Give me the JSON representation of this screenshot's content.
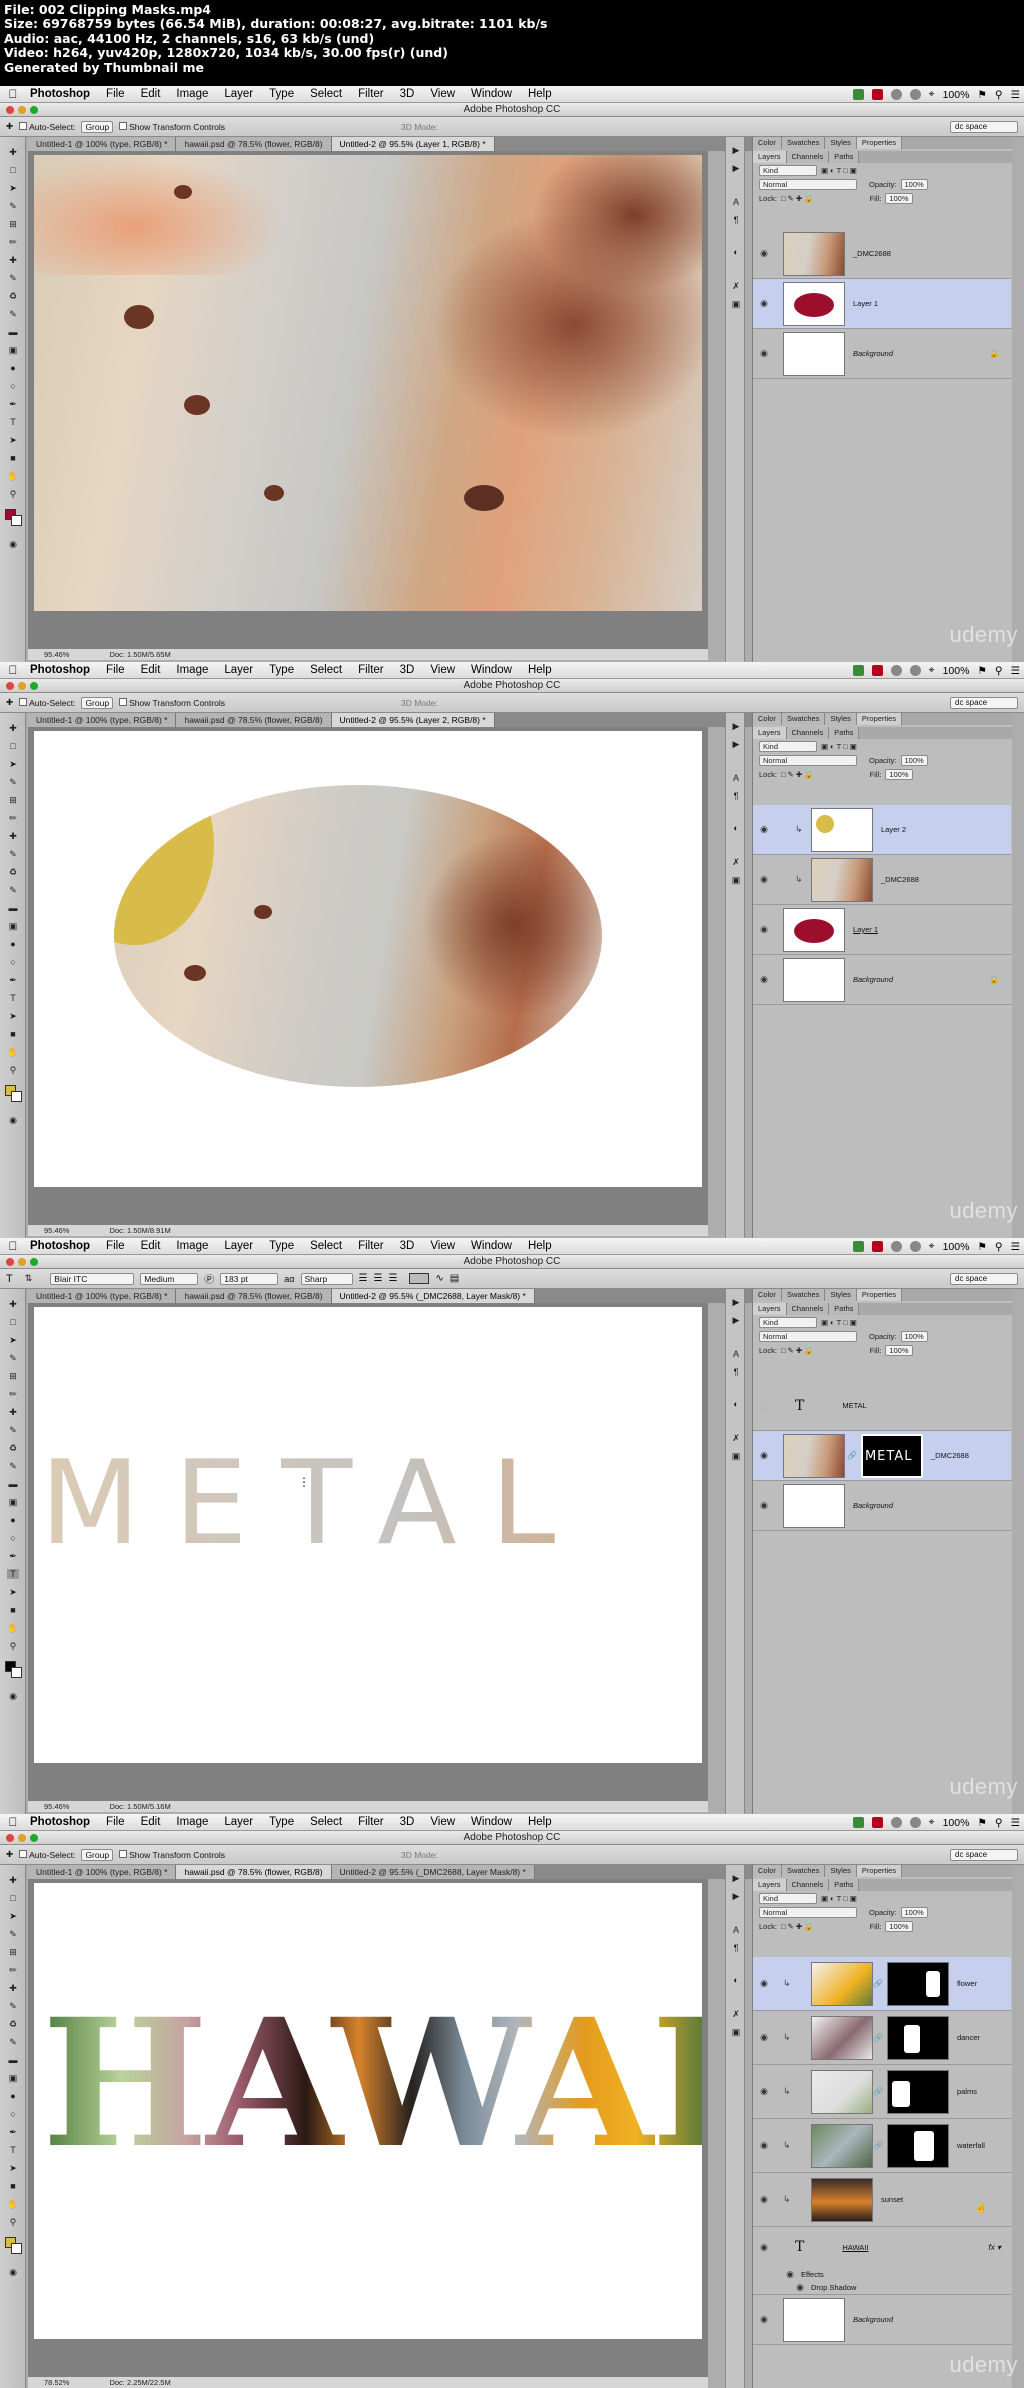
{
  "header": {
    "line1": "File: 002 Clipping Masks.mp4",
    "line2": "Size: 69768759 bytes (66.54 MiB), duration: 00:08:27, avg.bitrate: 1101 kb/s",
    "line3": "Audio: aac, 44100 Hz, 2 channels, s16, 63 kb/s (und)",
    "line4": "Video: h264, yuv420p, 1280x720, 1034 kb/s, 30.00 fps(r) (und)",
    "line5": "Generated by Thumbnail me"
  },
  "menubar": {
    "app": "Photoshop",
    "items": [
      "File",
      "Edit",
      "Image",
      "Layer",
      "Type",
      "Select",
      "Filter",
      "3D",
      "View",
      "Window",
      "Help"
    ],
    "battery": "100%"
  },
  "window_title": "Adobe Photoshop CC",
  "workspace": "dc space",
  "options": {
    "auto_select": "Auto-Select:",
    "group": "Group",
    "transform": "Show Transform Controls",
    "mode_3d": "3D Mode:"
  },
  "type_options": {
    "font": "Blair ITC",
    "style": "Medium",
    "size": "183 pt",
    "aa": "Sharp"
  },
  "panel_tabs": [
    "Color",
    "Swatches",
    "Styles",
    "Properties"
  ],
  "layer_tabs": [
    "Layers",
    "Channels",
    "Paths"
  ],
  "layers_ui": {
    "kind": "Kind",
    "blend": "Normal",
    "opacity_label": "Opacity:",
    "opacity": "100%",
    "lock_label": "Lock:",
    "fill_label": "Fill:",
    "fill": "100%"
  },
  "panels": [
    {
      "tabs": [
        "Untitled-1 @ 100% (type, RGB/8) *",
        "hawaii.psd @ 78.5% (flower, RGB/8)",
        "Untitled-2 @ 95.5% (Layer 1, RGB/8) *"
      ],
      "zoom": "95.46%",
      "doc": "Doc: 1.50M/5.65M",
      "layers": [
        {
          "name": "_DMC2688",
          "selected": false
        },
        {
          "name": "Layer 1",
          "selected": true
        },
        {
          "name": "Background",
          "selected": false
        }
      ]
    },
    {
      "tabs": [
        "Untitled-1 @ 100% (type, RGB/8) *",
        "hawaii.psd @ 78.5% (flower, RGB/8)",
        "Untitled-2 @ 95.5% (Layer 2, RGB/8) *"
      ],
      "zoom": "95.46%",
      "doc": "Doc: 1.50M/8.91M",
      "layers": [
        {
          "name": "Layer 2",
          "selected": true
        },
        {
          "name": "_DMC2688",
          "selected": false
        },
        {
          "name": "Layer 1",
          "selected": false
        },
        {
          "name": "Background",
          "selected": false
        }
      ]
    },
    {
      "tabs": [
        "Untitled-1 @ 100% (type, RGB/8) *",
        "hawaii.psd @ 78.5% (flower, RGB/8)",
        "Untitled-2 @ 95.5% (_DMC2688, Layer Mask/8) *"
      ],
      "zoom": "95.46%",
      "doc": "Doc: 1.50M/5.16M",
      "canvas_text": "METAL",
      "layers": [
        {
          "name": "METAL",
          "selected": false
        },
        {
          "name": "_DMC2688",
          "selected": true,
          "mask_text": "METAL"
        },
        {
          "name": "Background",
          "selected": false
        }
      ]
    },
    {
      "tabs": [
        "Untitled-1 @ 100% (type, RGB/8) *",
        "hawaii.psd @ 78.5% (flower, RGB/8)",
        "Untitled-2 @ 95.5% (_DMC2688, Layer Mask/8) *"
      ],
      "zoom": "78.52%",
      "doc": "Doc: 2.25M/22.5M",
      "canvas_text": "HAWAII",
      "layers": [
        {
          "name": "flower",
          "selected": true
        },
        {
          "name": "dancer",
          "selected": false
        },
        {
          "name": "palms",
          "selected": false
        },
        {
          "name": "waterfall",
          "selected": false
        },
        {
          "name": "sunset",
          "selected": false
        },
        {
          "name": "HAWAII",
          "selected": false
        },
        {
          "name": "Effects",
          "selected": false
        },
        {
          "name": "Drop Shadow",
          "selected": false
        },
        {
          "name": "Background",
          "selected": false
        }
      ]
    }
  ],
  "watermark": "udemy",
  "colors": {
    "layer_selected": "#c6d0ee",
    "accent_red": "#9b0f2c",
    "accent_yellow": "#d9bb4a"
  }
}
